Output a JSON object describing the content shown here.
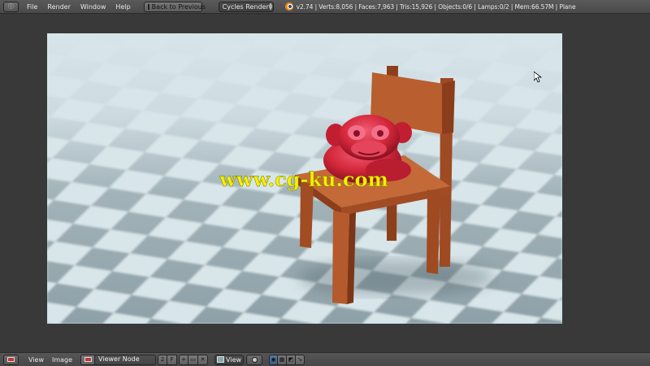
{
  "header": {
    "editor_icon": "info-editor-icon",
    "menus": [
      "File",
      "Render",
      "Window",
      "Help"
    ],
    "back_button": "Back to Previous",
    "render_engine": "Cycles Render",
    "stats": "v2.74 | Verts:8,056 | Faces:7,963 | Tris:15,926 | Objects:0/6 | Lamps:0/2 | Mem:66.57M | Plane"
  },
  "render": {
    "watermark": "www.cg-ku.com",
    "watermark_color": "#f5f000",
    "subject": "red-monkey-on-wooden-chair"
  },
  "footer": {
    "editor_icon": "image-editor-icon",
    "menus": [
      "View",
      "Image"
    ],
    "image_name": "Viewer Node",
    "users_count": "2",
    "fake_user": "F",
    "view_mode": "View"
  },
  "colors": {
    "header_bg": "#4e4e4e",
    "editor_bg": "#393939",
    "chair": "#b0562a",
    "monkey": "#d3263a",
    "floor_dark": "#8a9ca3",
    "floor_light": "#dbe8ec"
  }
}
